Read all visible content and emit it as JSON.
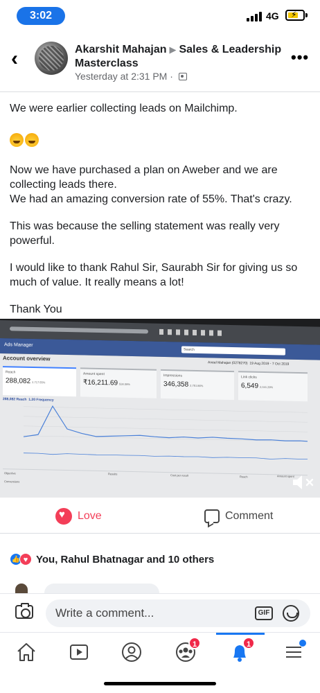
{
  "status_bar": {
    "time": "3:02",
    "network": "4G"
  },
  "header": {
    "author": "Akarshit Mahajan",
    "group": "Sales & Leadership Masterclass",
    "timestamp": "Yesterday at 2:31 PM",
    "separator": "·"
  },
  "post": {
    "paragraphs": [
      "We were earlier collecting leads on Mailchimp.",
      "Now we have purchased a plan on Aweber and we are collecting leads there.",
      "We had an amazing conversion rate of 55%. That's crazy.",
      "This was because the selling statement was really very powerful.",
      "I would like to thank Rahul Sir, Saurabh Sir for giving us so much of value. It really means a lot!",
      "Thank You"
    ]
  },
  "media": {
    "browser_title": "Ads Manager",
    "section": "Account overview",
    "search": "Search",
    "account": "Aneel Mahajan (0278270)",
    "date_range": "19 Aug 2019 - 7 Oct 2019",
    "cards": [
      {
        "label": "Reach",
        "value": "288,082",
        "delta": "2,717.55%"
      },
      {
        "label": "Amount spent",
        "value": "₹16,211.69",
        "delta": "534.09%"
      },
      {
        "label": "Impressions",
        "value": "346,358",
        "delta": "2,751.86%"
      },
      {
        "label": "Link clicks",
        "value": "6,549",
        "delta": "2,041.29%"
      }
    ],
    "reach_label": "288,082 Reach",
    "frequency_label": "1.20 Frequency",
    "table_headers": [
      "Objective",
      "Results",
      "Cost per result",
      "Reach",
      "Amount spent"
    ],
    "row_label": "Conversions",
    "reach_series": [
      0.05,
      0.12,
      0.95,
      0.3,
      0.18,
      0.1,
      0.12,
      0.14,
      0.16,
      0.13,
      0.11,
      0.14,
      0.12,
      0.15,
      0.13,
      0.12,
      0.1,
      0.11,
      0.09,
      0.1,
      0.08
    ],
    "freq_series": [
      0.5,
      0.5,
      0.45,
      0.52,
      0.5,
      0.48,
      0.5,
      0.49,
      0.5,
      0.47,
      0.5,
      0.48,
      0.5,
      0.46,
      0.5,
      0.49,
      0.5,
      0.44,
      0.5,
      0.48,
      0.5
    ]
  },
  "actions": {
    "love": "Love",
    "comment": "Comment"
  },
  "reactions": {
    "text": "You, Rahul Bhatnagar and 10 others"
  },
  "composer": {
    "placeholder": "Write a comment...",
    "gif": "GIF"
  },
  "tabbar": {
    "items": [
      {
        "name": "home",
        "badge": ""
      },
      {
        "name": "watch",
        "badge": ""
      },
      {
        "name": "profile",
        "badge": ""
      },
      {
        "name": "groups",
        "badge": "1"
      },
      {
        "name": "notifications",
        "badge": "1"
      },
      {
        "name": "menu",
        "badge": ""
      }
    ]
  },
  "colors": {
    "fb_blue": "#1877f2",
    "love_red": "#f33e58",
    "badge_red": "#f02849",
    "time_pill": "#1a73e8"
  }
}
